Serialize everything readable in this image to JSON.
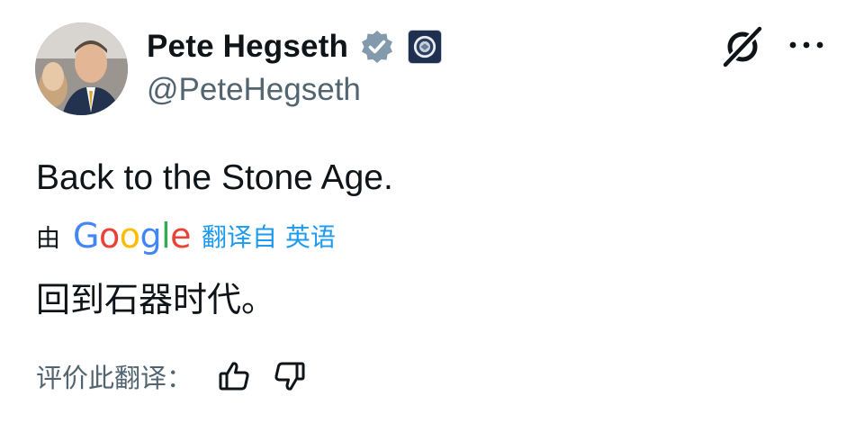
{
  "author": {
    "display_name": "Pete Hegseth",
    "handle": "@PeteHegseth",
    "avatar_icon": "profile-photo",
    "verified_badge_color": "#829aab",
    "affiliate_badge_icon": "department-seal-icon"
  },
  "header_actions": {
    "grok_icon": "grok-icon",
    "more_icon": "more-horizontal-icon"
  },
  "tweet": {
    "text": "Back to the Stone Age."
  },
  "translation": {
    "by_label": "由",
    "provider_letters": [
      "G",
      "o",
      "o",
      "g",
      "l",
      "e"
    ],
    "provider_colors": [
      "#4285f4",
      "#ea4335",
      "#fbbc05",
      "#4285f4",
      "#34a853",
      "#ea4335"
    ],
    "link_label": "翻译自 英语",
    "translated_text": "回到石器时代。",
    "link_color": "#1d9bf0"
  },
  "feedback": {
    "label": "评价此翻译：",
    "thumbs_up_icon": "thumbs-up-icon",
    "thumbs_down_icon": "thumbs-down-icon"
  }
}
